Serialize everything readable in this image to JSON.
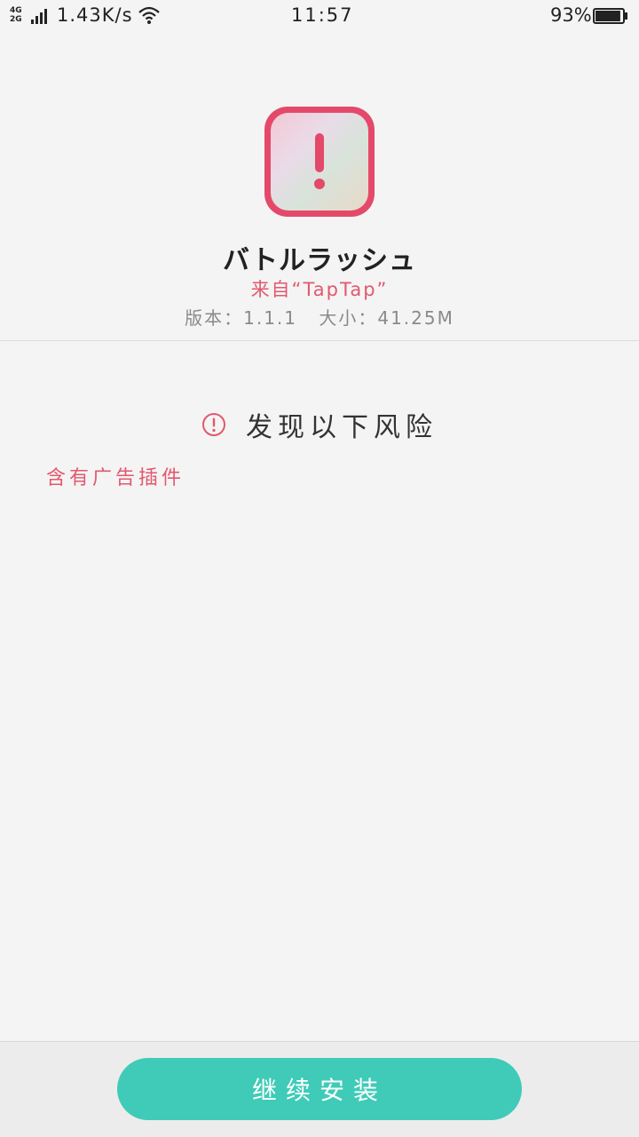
{
  "status_bar": {
    "network_top": "4G",
    "network_bottom": "2G",
    "net_speed": "1.43K/s",
    "time": "11:57",
    "battery_percent": "93%",
    "battery_level": 0.93,
    "icons": [
      "signal-icon",
      "wifi-icon",
      "battery-icon"
    ]
  },
  "app": {
    "name": "バトルラッシュ",
    "source": "来自“TapTap”",
    "version_label": "版本：",
    "version": "1.1.1",
    "size_label": "大小：",
    "size": "41.25M",
    "icon": "app-warning-icon"
  },
  "risk": {
    "title": "发现以下风险",
    "icon": "alert-circle-icon",
    "items": [
      "含有广告插件"
    ]
  },
  "actions": {
    "continue_install": "继续安装"
  },
  "colors": {
    "accent_green": "#3fcbb7",
    "warning_red": "#e2586e",
    "icon_border": "#e4496a"
  }
}
